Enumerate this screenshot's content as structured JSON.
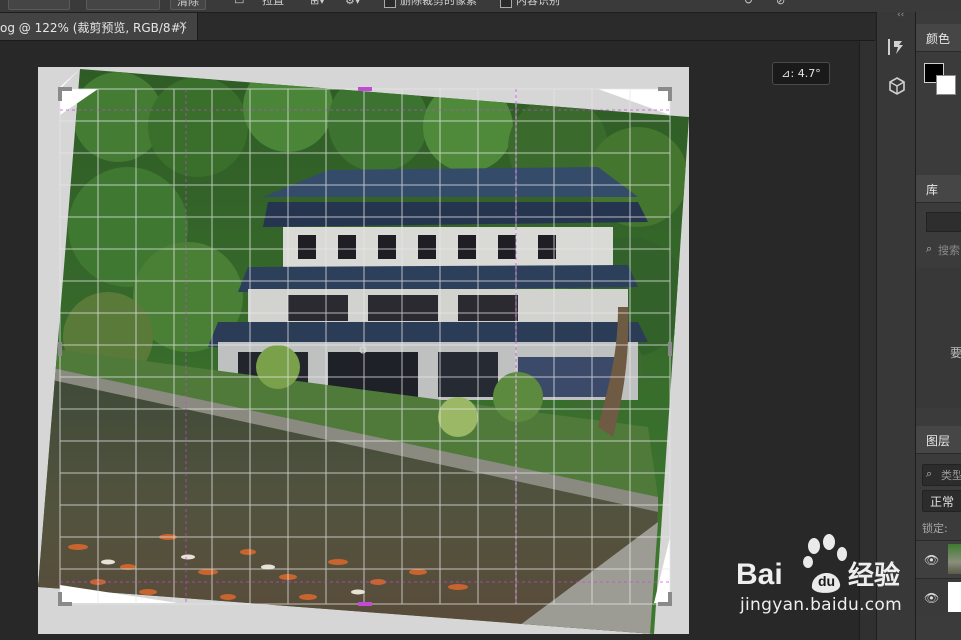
{
  "options_bar": {
    "clear_button": "清除",
    "straighten_label": "拉直",
    "delete_cropped_pixels": "删除裁剪的像素",
    "content_aware": "内容识别"
  },
  "document_tab": {
    "title": "og @ 122% (裁剪预览, RGB/8#)",
    "close_glyph": "×"
  },
  "canvas": {
    "angle_readout": "⊿: 4.7°"
  },
  "panels": {
    "collapse_glyph": "‹‹",
    "color_tab": "颜色",
    "library_tab": "库",
    "library_search_icon": "⌕",
    "library_search_placeholder": "搜索",
    "library_need_text": "要",
    "layers_tab": "图层",
    "layers_search_icon": "⌕",
    "layers_filter_placeholder": "类型",
    "blend_mode": "正常",
    "lock_label": "锁定:",
    "eye_glyph": "👁",
    "colors": {
      "foreground": "#000000",
      "background": "#ffffff"
    }
  },
  "watermark": {
    "logo_text": "Baidu经验",
    "url": "jingyan.baidu.com"
  }
}
